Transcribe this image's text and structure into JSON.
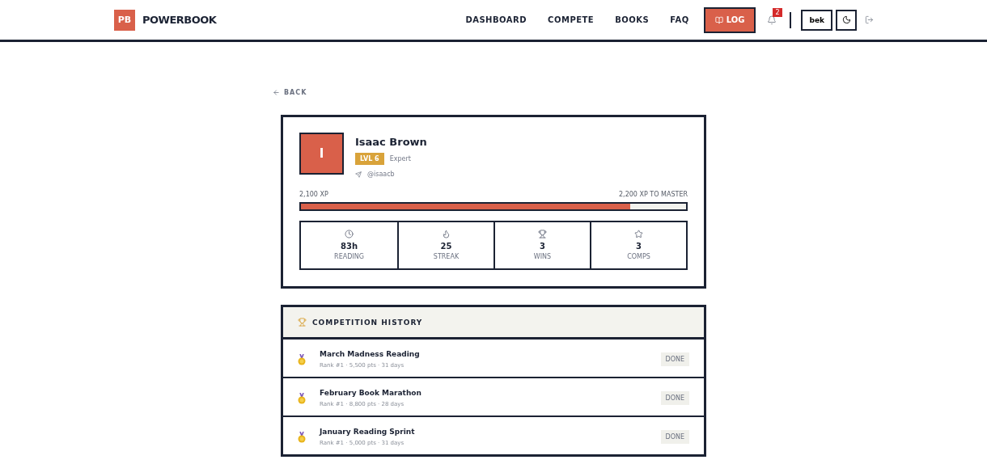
{
  "brand": {
    "logo": "PB",
    "name": "POWERBOOK"
  },
  "nav": [
    {
      "label": "DASHBOARD"
    },
    {
      "label": "COMPETE"
    },
    {
      "label": "BOOKS"
    },
    {
      "label": "FAQ"
    }
  ],
  "log_button": "LOG",
  "notifications": {
    "count": "2"
  },
  "user_button": "bek",
  "back": "BACK",
  "profile": {
    "initial": "I",
    "name": "Isaac Brown",
    "level": "LVL 6",
    "title": "Expert",
    "handle": "@isaacb",
    "xp": "2,100 XP",
    "xp_next": "2,200 XP TO MASTER",
    "level_progress": {
      "level": 0.855
    }
  },
  "stats": [
    {
      "kind": "clock",
      "value": "83h",
      "label": "READING"
    },
    {
      "kind": "flame",
      "value": "25",
      "label": "STREAK"
    },
    {
      "kind": "trophy",
      "value": "3",
      "label": "WINS"
    },
    {
      "kind": "star",
      "value": "3",
      "label": "COMPS"
    }
  ],
  "history": {
    "title": "COMPETITION HISTORY",
    "items": [
      {
        "name": "March Madness Reading",
        "meta": "Rank #1 · 5,500 pts · 31 days",
        "status": "DONE"
      },
      {
        "name": "February Book Marathon",
        "meta": "Rank #1 · 8,800 pts · 28 days",
        "status": "DONE"
      },
      {
        "name": "January Reading Sprint",
        "meta": "Rank #1 · 5,000 pts · 31 days",
        "status": "DONE"
      }
    ]
  }
}
